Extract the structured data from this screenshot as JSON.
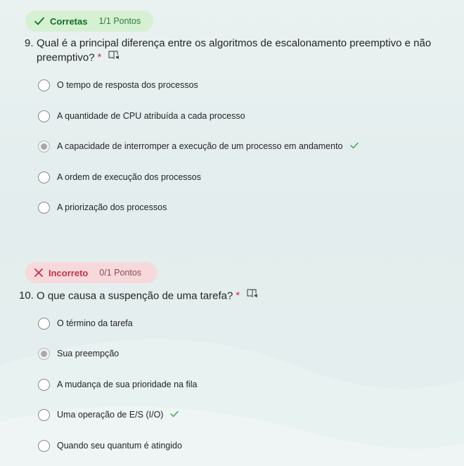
{
  "questions": [
    {
      "result_label": "Corretas",
      "points": "1/1 Pontos",
      "number": "9.",
      "text_line1": "Qual é a principal diferença entre os algoritmos de escalonamento preemptivo e não",
      "text_line2": "preemptivo?",
      "required_mark": "*",
      "options": [
        {
          "label": "O tempo de resposta dos processos",
          "selected": false,
          "correct": false
        },
        {
          "label": "A quantidade de CPU atribuída a cada processo",
          "selected": false,
          "correct": false
        },
        {
          "label": "A capacidade de interromper a execução de um processo em andamento",
          "selected": true,
          "correct": true
        },
        {
          "label": "A ordem de execução dos processos",
          "selected": false,
          "correct": false
        },
        {
          "label": "A priorização dos processos",
          "selected": false,
          "correct": false
        }
      ]
    },
    {
      "result_label": "Incorreto",
      "points": "0/1 Pontos",
      "number": "10.",
      "text_line1": "O que causa a suspenção de uma tarefa?",
      "required_mark": "*",
      "options": [
        {
          "label": "O término da tarefa",
          "selected": false,
          "correct": false
        },
        {
          "label": "Sua preempção",
          "selected": true,
          "correct": false
        },
        {
          "label": "A mudança de sua prioridade na fila",
          "selected": false,
          "correct": false
        },
        {
          "label": "Uma operação de E/S (I/O)",
          "selected": false,
          "correct": true
        },
        {
          "label": "Quando seu quantum é atingido",
          "selected": false,
          "correct": false
        }
      ]
    }
  ],
  "icons": {
    "correct": "checkmark-icon",
    "incorrect": "x-mark-icon",
    "reader": "immersive-reader-icon"
  },
  "colors": {
    "correct_green": "#0e6f23",
    "incorrect_red": "#c4314b",
    "correct_badge_bg": "#d6f0d3",
    "incorrect_badge_bg": "#f7d9dc"
  }
}
